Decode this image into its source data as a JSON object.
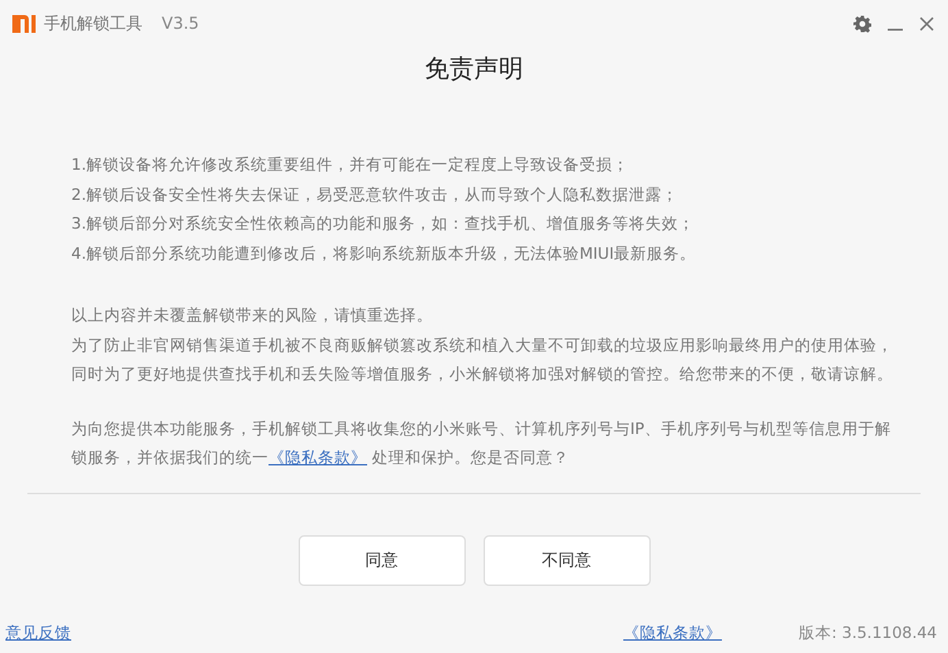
{
  "window": {
    "title": "手机解锁工具",
    "version": "V3.5"
  },
  "heading": "免责声明",
  "risks": [
    "1.解锁设备将允许修改系统重要组件，并有可能在一定程度上导致设备受损；",
    "2.解锁后设备安全性将失去保证，易受恶意软件攻击，从而导致个人隐私数据泄露；",
    "3.解锁后部分对系统安全性依赖高的功能和服务，如：查找手机、增值服务等将失效；",
    "4.解锁后部分系统功能遭到修改后，将影响系统新版本升级，无法体验MIUI最新服务。"
  ],
  "notice": [
    "以上内容并未覆盖解锁带来的风险，请慎重选择。",
    "为了防止非官网销售渠道手机被不良商贩解锁篡改系统和植入大量不可卸载的垃圾应用影响最终用户的使用体验，",
    "同时为了更好地提供查找手机和丢失险等增值服务，小米解锁将加强对解锁的管控。给您带来的不便，敬请谅解。"
  ],
  "consent": {
    "before": "为向您提供本功能服务，手机解锁工具将收集您的小米账号、计算机序列号与IP、手机序列号与机型等信息用于解锁服务，并依据我们的统一",
    "link": "《隐私条款》",
    "after": " 处理和保护。您是否同意？"
  },
  "buttons": [
    "同意",
    "不同意"
  ],
  "footer": {
    "feedback": "意见反馈",
    "privacy": "《隐私条款》",
    "version": "版本: 3.5.1108.44"
  }
}
